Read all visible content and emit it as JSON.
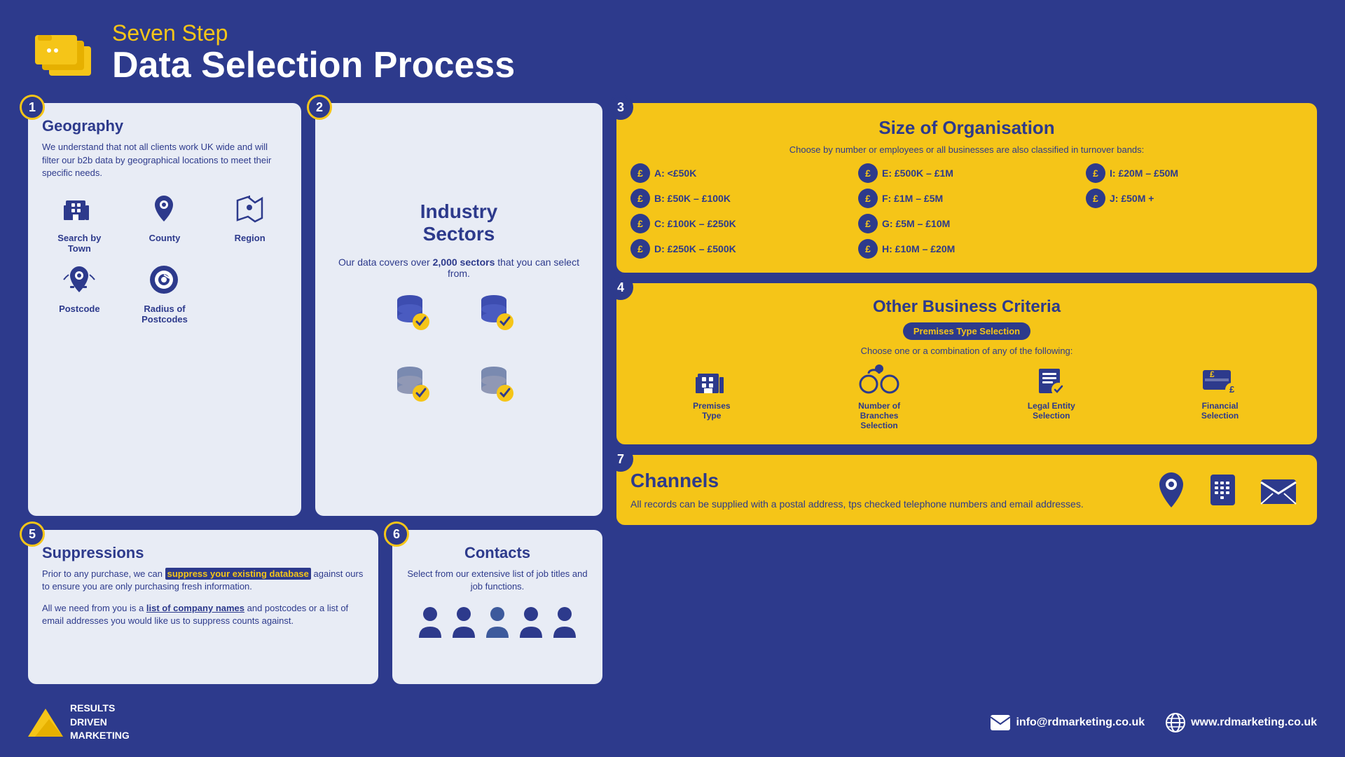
{
  "header": {
    "subtitle": "Seven Step",
    "title": "Data Selection Process"
  },
  "steps": {
    "geography": {
      "step": "1",
      "title": "Geography",
      "description": "We understand that not all clients work UK wide and will filter our b2b data by geographical locations to meet their specific needs.",
      "items": [
        {
          "label": "Search by Town"
        },
        {
          "label": "County"
        },
        {
          "label": "Region"
        },
        {
          "label": "Postcode"
        },
        {
          "label": "Radius of Postcodes"
        }
      ]
    },
    "industry": {
      "step": "2",
      "title": "Industry Sectors",
      "description": "Our data covers over 2,000 sectors that you can select from.",
      "sectors_count": "2,000"
    },
    "size": {
      "step": "3",
      "title": "Size of Organisation",
      "subtitle": "Choose by number or employees or all businesses are also classified in turnover bands:",
      "bands": [
        {
          "label": "A: <£50K"
        },
        {
          "label": "E: £500K – £1M"
        },
        {
          "label": "I: £20M – £50M"
        },
        {
          "label": "B: £50K – £100K"
        },
        {
          "label": "F: £1M – £5M"
        },
        {
          "label": "J: £50M +"
        },
        {
          "label": "C: £100K – £250K"
        },
        {
          "label": "G: £5M – £10M"
        },
        {
          "label": ""
        },
        {
          "label": "D: £250K – £500K"
        },
        {
          "label": "H: £10M – £20M"
        },
        {
          "label": ""
        }
      ]
    },
    "business": {
      "step": "4",
      "title": "Other Business Criteria",
      "badge": "Premises Type Selection",
      "subtitle": "Choose one or a combination of any of the following:",
      "items": [
        {
          "label": "Premises Type"
        },
        {
          "label": "Number of Branches Selection"
        },
        {
          "label": "Legal Entity Selection"
        },
        {
          "label": "Financial Selection"
        }
      ]
    },
    "suppressions": {
      "step": "5",
      "title": "Suppressions",
      "para1_before": "Prior to any purchase, we can ",
      "para1_highlight": "suppress your existing database",
      "para1_after": " against ours to ensure you are only purchasing fresh information.",
      "para2_before": "All we need from you is a ",
      "para2_highlight": "list of company names",
      "para2_after": " and postcodes or a list of email addresses you would like us to suppress counts against."
    },
    "contacts": {
      "step": "6",
      "title": "Contacts",
      "description": "Select from our extensive list of job titles and job functions."
    },
    "channels": {
      "step": "7",
      "title": "Channels",
      "description": "All records can be supplied with a postal address, tps checked telephone numbers and email addresses."
    }
  },
  "footer": {
    "logo_line1": "RESULTS",
    "logo_line2": "DRIVEN",
    "logo_line3": "MARKETING",
    "email": "info@rdmarketing.co.uk",
    "website": "www.rdmarketing.co.uk"
  }
}
